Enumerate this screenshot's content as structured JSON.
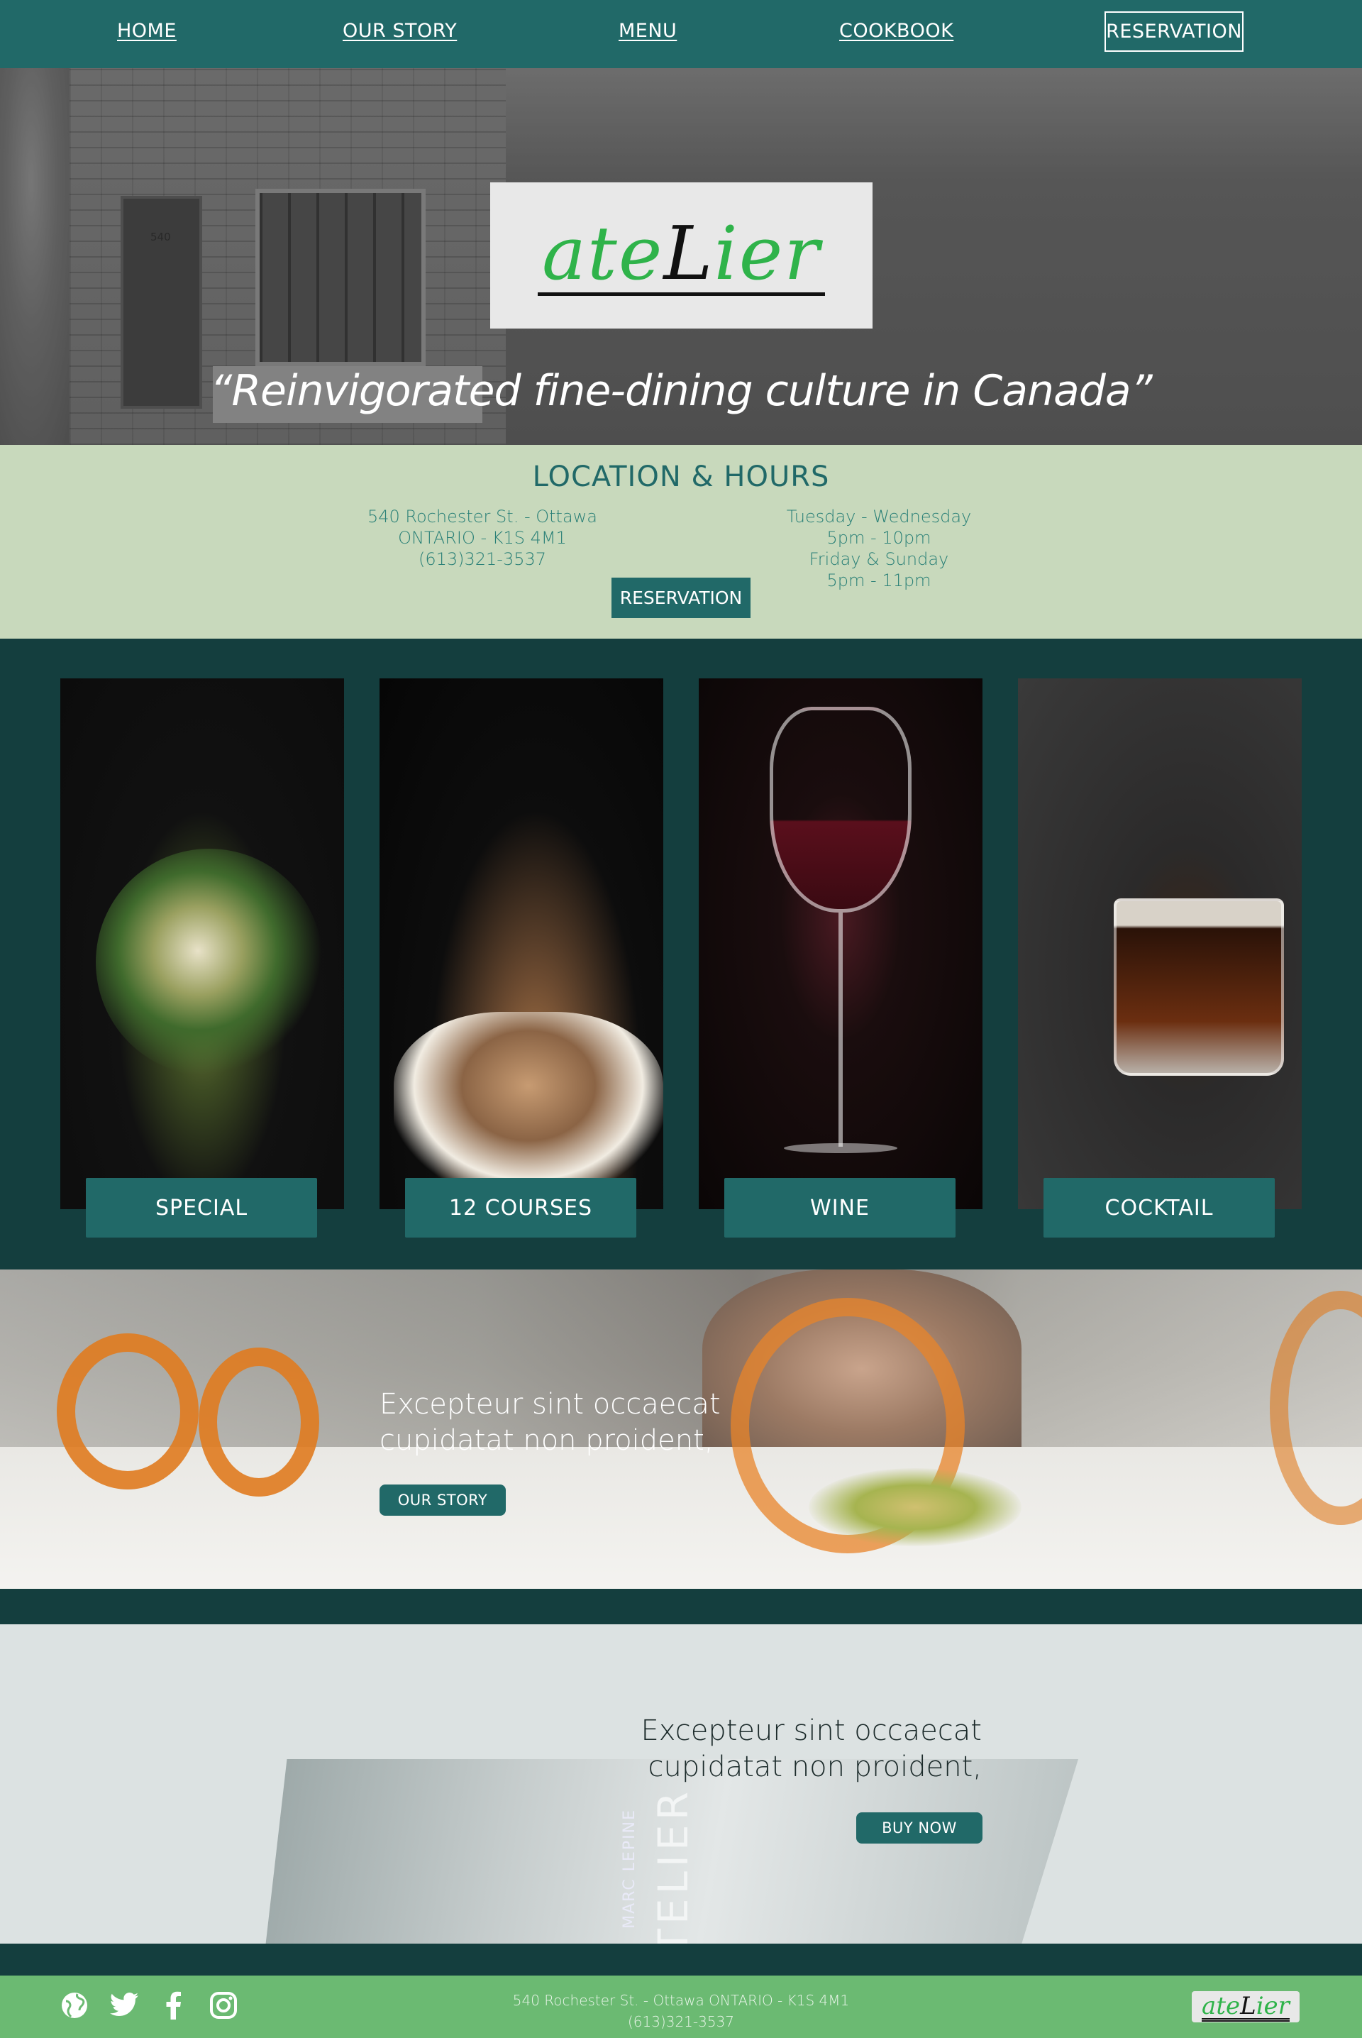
{
  "nav": {
    "items": [
      {
        "label": "HOME"
      },
      {
        "label": "OUR STORY"
      },
      {
        "label": "MENU"
      },
      {
        "label": "COOKBOOK"
      }
    ],
    "reservation": "RESERVATION"
  },
  "hero": {
    "logo": {
      "part1": "ate",
      "part2": "L",
      "part3": "ier"
    },
    "door_number": "540",
    "quote": "“Reinvigorated fine-dining culture in Canada”"
  },
  "location": {
    "title": "LOCATION & HOURS",
    "address": [
      "540 Rochester St. - Ottawa",
      "ONTARIO - K1S 4M1",
      "(613)321-3537"
    ],
    "hours": [
      "Tuesday - Wednesday",
      "5pm - 10pm",
      "Friday & Sunday",
      "5pm - 11pm"
    ],
    "reservation": "RESERVATION"
  },
  "cards": [
    {
      "label": "SPECIAL"
    },
    {
      "label": "12 COURSES"
    },
    {
      "label": "WINE"
    },
    {
      "label": "COCKTAIL"
    }
  ],
  "story": {
    "line1": "Excepteur sint occaecat",
    "line2": "cupidatat non proident,",
    "button": "OUR STORY"
  },
  "cookbook": {
    "line1": "Excepteur sint occaecat",
    "line2": "cupidatat non proident,",
    "button": "BUY NOW",
    "spine_small": "MARC LEPINE",
    "spine_big": "ATELIER"
  },
  "footer": {
    "address_line1": "540 Rochester St. - Ottawa  ONTARIO - K1S 4M1",
    "address_line2": "(613)321-3537",
    "social_icons": [
      "globe-icon",
      "twitter-icon",
      "facebook-icon",
      "instagram-icon"
    ],
    "logo": {
      "part1": "ate",
      "part2": "L",
      "part3": "ier"
    }
  },
  "colors": {
    "nav": "#216968",
    "location_bg": "#c8d9bc",
    "dark_bg": "#143e3e",
    "footer": "#6bba72",
    "logo_green": "#2fb34a"
  }
}
